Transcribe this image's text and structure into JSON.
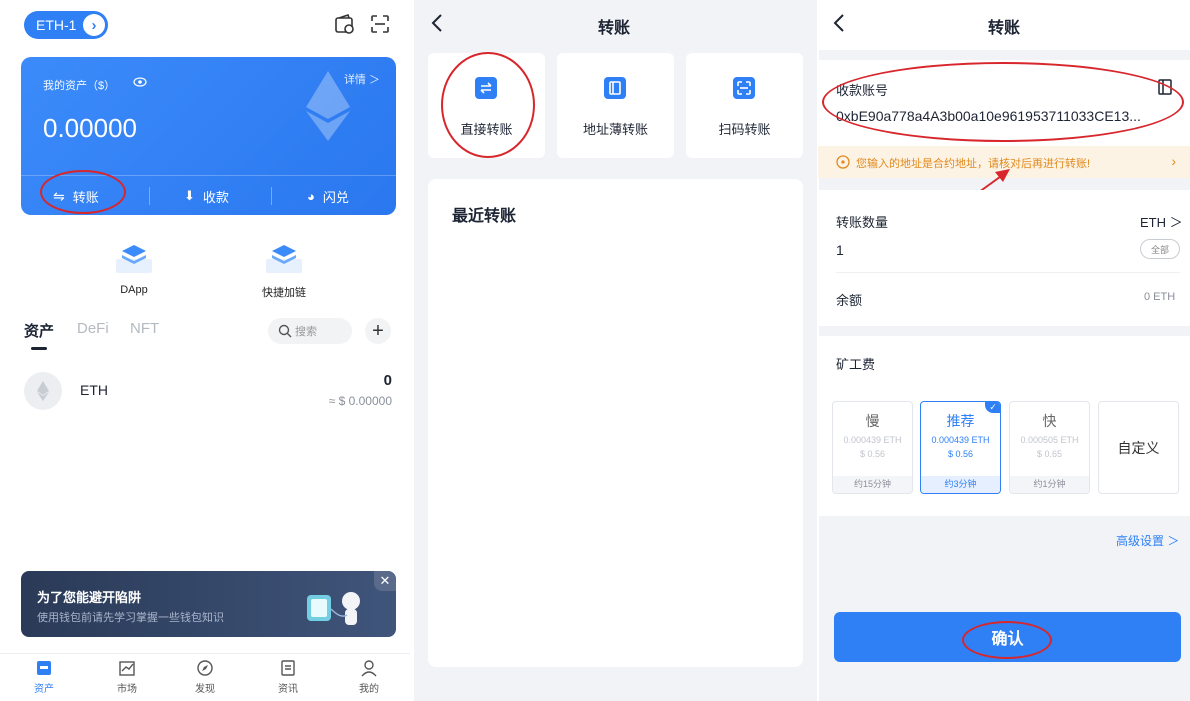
{
  "wallet": {
    "network_label": "ETH-1",
    "asset_label": "我的资产（$）",
    "detail_link": "详情 ＞",
    "balance": "0.00000",
    "actions": {
      "transfer": "转账",
      "receive": "收款",
      "swap": "闪兑"
    },
    "quick_links": [
      "DApp",
      "快捷加链"
    ],
    "tabs": [
      "资产",
      "DeFi",
      "NFT"
    ],
    "search_placeholder": "搜索",
    "token": {
      "symbol": "ETH",
      "amount": "0",
      "usd": "≈ $ 0.00000"
    },
    "banner": {
      "title": "为了您能避开陷阱",
      "subtitle": "使用钱包前请先学习掌握一些钱包知识"
    },
    "nav": [
      "资产",
      "市场",
      "发现",
      "资讯",
      "我的"
    ]
  },
  "transfer_menu": {
    "title": "转账",
    "options": [
      "直接转账",
      "地址薄转账",
      "扫码转账"
    ],
    "recent_title": "最近转账"
  },
  "transfer_form": {
    "title": "转账",
    "recipient_label": "收款账号",
    "recipient_address": "0xbE90a778a4A3b00a10e961953711033CE13...",
    "warning": "您输入的地址是合约地址，请核对后再进行转账!",
    "amount_label": "转账数量",
    "asset_selector": "ETH ＞",
    "amount_value": "1",
    "all_button": "全部",
    "balance_label": "余额",
    "balance_value": "0 ETH",
    "fee_label": "矿工费",
    "fees": [
      {
        "name": "慢",
        "eth": "0.000439 ETH",
        "usd": "$ 0.56",
        "time": "约15分钟",
        "selected": false
      },
      {
        "name": "推荐",
        "eth": "0.000439 ETH",
        "usd": "$ 0.56",
        "time": "约3分钟",
        "selected": true
      },
      {
        "name": "快",
        "eth": "0.000505 ETH",
        "usd": "$ 0.65",
        "time": "约1分钟",
        "selected": false
      }
    ],
    "custom_fee": "自定义",
    "advanced": "高级设置 ＞",
    "confirm": "确认"
  },
  "colors": {
    "accent": "#2f80f5",
    "warning": "#e08a1c",
    "annotation": "#d7262c"
  }
}
